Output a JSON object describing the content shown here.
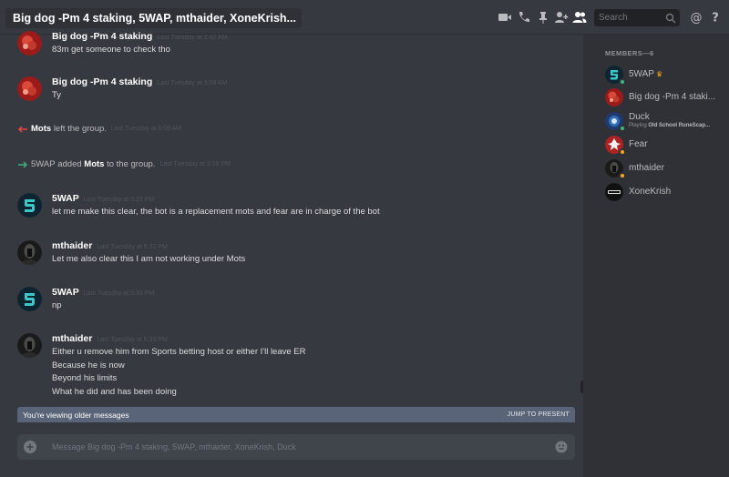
{
  "header": {
    "title": "Big dog -Pm 4 staking, 5WAP, mthaider, XoneKrish...",
    "search_placeholder": "Search",
    "icons": [
      "video-call-icon",
      "voice-call-icon",
      "pin-icon",
      "add-friend-icon",
      "members-icon",
      "search-icon",
      "mention-icon",
      "help-icon"
    ]
  },
  "messages": [
    {
      "author": "Big dog -Pm 4 staking",
      "timestamp": "Last Tuesday at 2:42 AM",
      "lines": [
        "83m get someone to check tho"
      ]
    },
    {
      "author": "Big dog -Pm 4 staking",
      "timestamp": "Last Tuesday at 3:08 AM",
      "lines": [
        "Ty"
      ]
    },
    {
      "author": "5WAP",
      "timestamp": "Last Tuesday at 5:29 PM",
      "lines": [
        "let me make this clear, the bot is a replacement mots and fear are in charge of the bot"
      ]
    },
    {
      "author": "mthaider",
      "timestamp": "Last Tuesday at 5:32 PM",
      "lines": [
        "Let me also clear this I am not working under Mots"
      ]
    },
    {
      "author": "5WAP",
      "timestamp": "Last Tuesday at 5:33 PM",
      "lines": [
        "np"
      ]
    },
    {
      "author": "mthaider",
      "timestamp": "Last Tuesday at 5:33 PM",
      "lines": [
        "Either u remove him from Sports betting host or either I'll leave ER",
        "Because he is now",
        "Beyond his limits",
        "What he did and has been doing"
      ]
    }
  ],
  "system": [
    {
      "actor": "Mots",
      "text": "left the group.",
      "timestamp": "Last Tuesday at 6:08 AM"
    },
    {
      "actor": "5WAP",
      "text_before": "added",
      "target": "Mots",
      "text_after": "to the group.",
      "timestamp": "Last Tuesday at 5:28 PM"
    }
  ],
  "older_bar": {
    "text": "You're viewing older messages",
    "jump": "JUMP TO PRESENT"
  },
  "composer": {
    "placeholder": "Message Big dog -Pm 4 staking, 5WAP, mthaider, XoneKrish, Duck"
  },
  "members": {
    "header": "MEMBERS—6",
    "list": [
      {
        "name": "5WAP",
        "status": "online",
        "status_color": "#43b581",
        "owner": true
      },
      {
        "name": "Big dog -Pm 4 staki...",
        "status": "none"
      },
      {
        "name": "Duck",
        "activity_prefix": "Playing",
        "activity": "Old School RuneScap...",
        "status": "online",
        "status_color": "#43b581"
      },
      {
        "name": "Fear",
        "status": "idle",
        "status_color": "#faa61a"
      },
      {
        "name": "mthaider",
        "status": "idle",
        "status_color": "#faa61a"
      },
      {
        "name": "XoneKrish",
        "status": "none"
      }
    ]
  },
  "colors": {
    "background": "#36393f",
    "sidebar": "#2f3136",
    "accent_green": "#43b581",
    "leave_red": "#f04747",
    "idle": "#faa61a"
  }
}
